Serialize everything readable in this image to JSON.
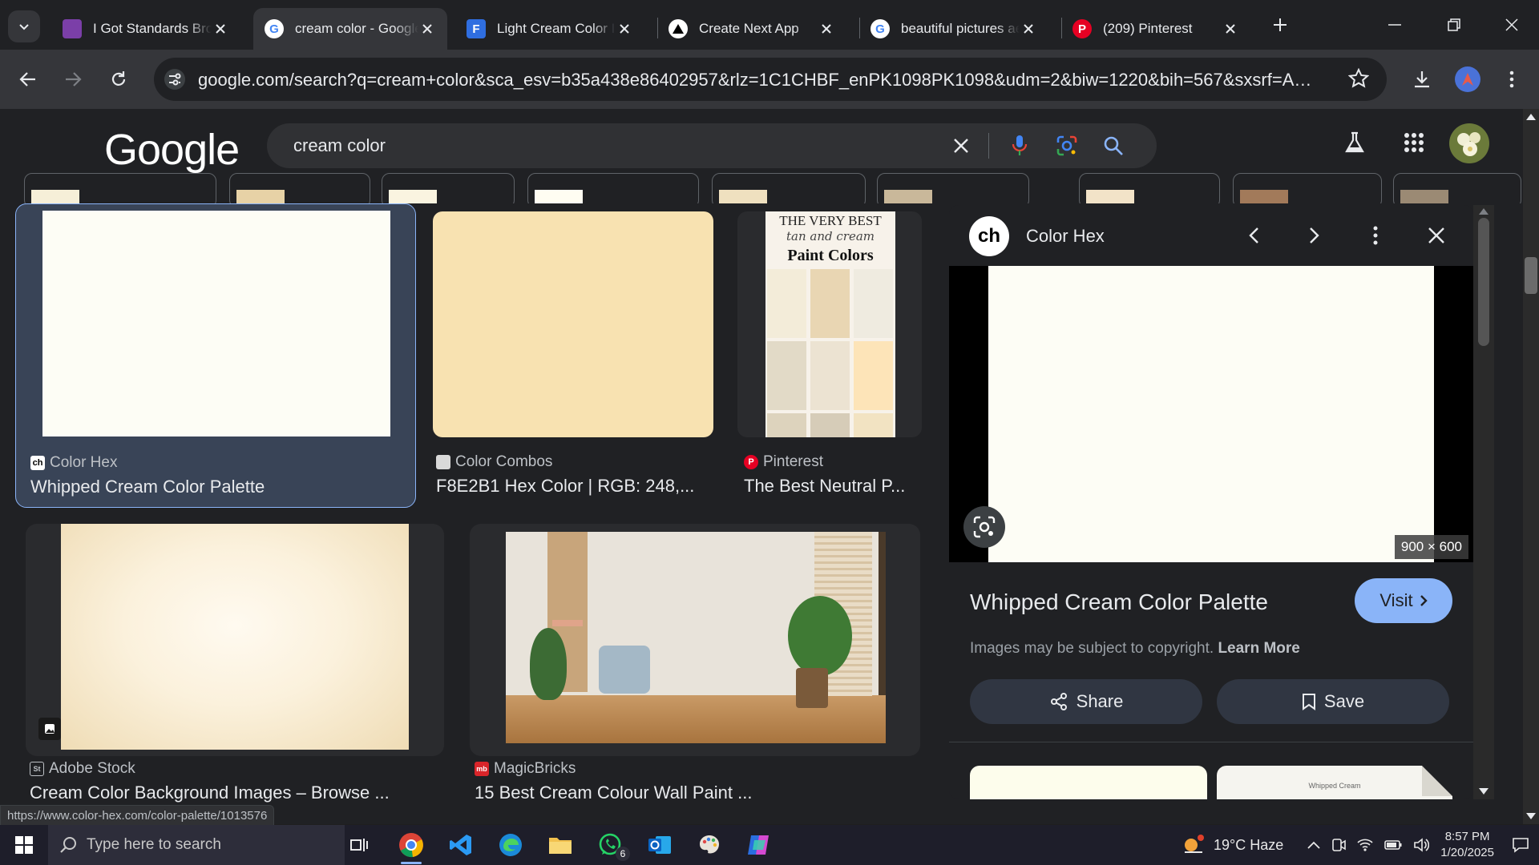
{
  "browser": {
    "tabs": [
      {
        "title": "I Got Standards Bro",
        "favicon": "purple-doc-icon",
        "active": false
      },
      {
        "title": "cream color - Google Search",
        "favicon": "google-g-icon",
        "active": true
      },
      {
        "title": "Light Cream Color In",
        "favicon": "blue-f-icon",
        "active": false
      },
      {
        "title": "Create Next App",
        "favicon": "triangle-icon",
        "active": false
      },
      {
        "title": "beautiful pictures ae",
        "favicon": "google-g-icon",
        "active": false
      },
      {
        "title": "(209) Pinterest",
        "favicon": "pinterest-icon",
        "active": false
      }
    ],
    "url": "google.com/search?q=cream+color&sca_esv=b35a438e86402957&rlz=1C1CHBF_enPK1098PK1098&udm=2&biw=1220&bih=567&sxsrf=ADLYWIL..."
  },
  "google": {
    "logo": "Google",
    "query": "cream color"
  },
  "results": [
    {
      "source": "Color Hex",
      "title": "Whipped Cream Color Palette",
      "fav_text": "ch"
    },
    {
      "source": "Color Combos",
      "title": "F8E2B1 Hex Color | RGB: 248,...",
      "fav_text": ""
    },
    {
      "source": "Pinterest",
      "title": "The Best Neutral P...",
      "fav_text": "P"
    },
    {
      "source": "Adobe Stock",
      "title": "Cream Color Background Images – Browse ...",
      "fav_text": "St"
    },
    {
      "source": "MagicBricks",
      "title": "15 Best Cream Colour Wall Paint ...",
      "fav_text": "mb"
    }
  ],
  "pinterest_image": {
    "title_line1": "THE VERY BEST",
    "title_line2": "tan and cream",
    "title_line3": "Paint Colors"
  },
  "panel": {
    "site_icon": "ch",
    "site_name": "Color Hex",
    "dimensions": "900 × 600",
    "title": "Whipped Cream Color Palette",
    "visit_label": "Visit",
    "copyright_text": "Images may be subject to copyright.",
    "learn_more": "Learn More",
    "share_label": "Share",
    "save_label": "Save",
    "related_caption": "Whipped Cream"
  },
  "status_url": "https://www.color-hex.com/color-palette/1013576",
  "taskbar": {
    "search_placeholder": "Type here to search",
    "outlook_badge": "6",
    "weather": "19°C  Haze",
    "time": "8:57 PM",
    "date": "1/20/2025"
  },
  "colors": {
    "cream_palette": "#fdfdf5",
    "f8e2b1": "#f8e2b1",
    "accent_blue": "#8ab4f8",
    "selected_card": "#394457"
  }
}
